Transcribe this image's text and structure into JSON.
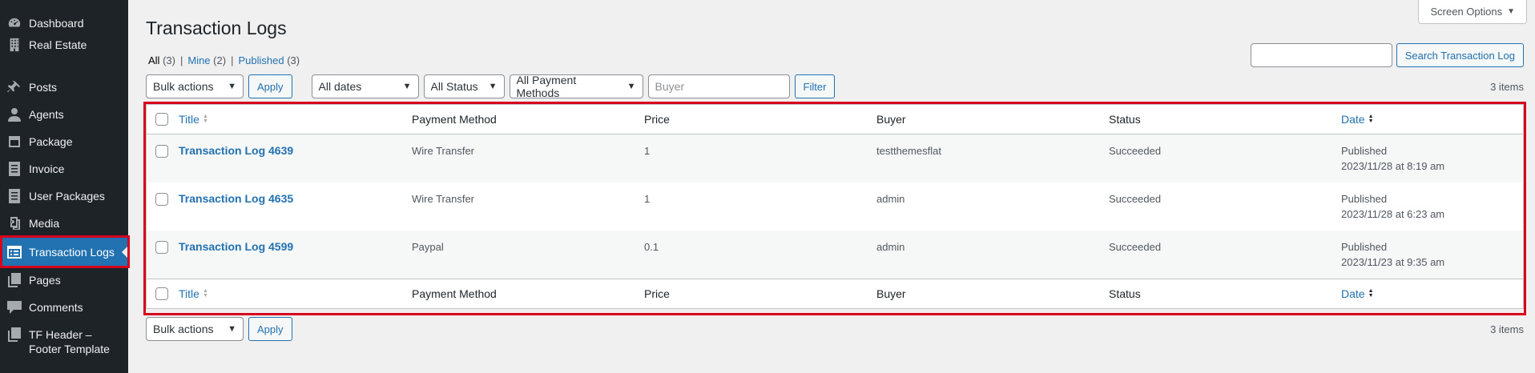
{
  "sidebar": {
    "items": [
      {
        "label": "Dashboard",
        "icon": "dashboard-icon",
        "current": false
      },
      {
        "label": "Real Estate",
        "icon": "building-icon",
        "current": false
      },
      {
        "label": "Posts",
        "icon": "pin-icon",
        "current": false
      },
      {
        "label": "Agents",
        "icon": "user-icon",
        "current": false
      },
      {
        "label": "Package",
        "icon": "box-icon",
        "current": false
      },
      {
        "label": "Invoice",
        "icon": "document-icon",
        "current": false
      },
      {
        "label": "User Packages",
        "icon": "document-icon",
        "current": false
      },
      {
        "label": "Media",
        "icon": "media-icon",
        "current": false
      },
      {
        "label": "Transaction Logs",
        "icon": "list-icon",
        "current": true
      },
      {
        "label": "Pages",
        "icon": "pages-icon",
        "current": false
      },
      {
        "label": "Comments",
        "icon": "comment-icon",
        "current": false
      },
      {
        "label": "TF Header – Footer Template",
        "icon": "pages-icon",
        "current": false
      }
    ]
  },
  "header": {
    "title": "Transaction Logs",
    "screen_options": "Screen Options"
  },
  "filters": {
    "all": "All",
    "all_count": "(3)",
    "mine": "Mine",
    "mine_count": "(2)",
    "published": "Published",
    "published_count": "(3)",
    "sep": "|"
  },
  "search": {
    "placeholder": "",
    "button": "Search Transaction Log"
  },
  "tablenav": {
    "bulk_actions": "Bulk actions",
    "apply": "Apply",
    "all_dates": "All dates",
    "all_status": "All Status",
    "all_payment_methods": "All Payment Methods",
    "buyer_placeholder": "Buyer",
    "filter": "Filter",
    "items_count": "3 items"
  },
  "table": {
    "columns": {
      "title": "Title",
      "payment_method": "Payment Method",
      "price": "Price",
      "buyer": "Buyer",
      "status": "Status",
      "date": "Date"
    },
    "rows": [
      {
        "title": "Transaction Log 4639",
        "payment_method": "Wire Transfer",
        "price": "1",
        "buyer": "testthemesflat",
        "status": "Succeeded",
        "date_status": "Published",
        "date": "2023/11/28 at 8:19 am"
      },
      {
        "title": "Transaction Log 4635",
        "payment_method": "Wire Transfer",
        "price": "1",
        "buyer": "admin",
        "status": "Succeeded",
        "date_status": "Published",
        "date": "2023/11/28 at 6:23 am"
      },
      {
        "title": "Transaction Log 4599",
        "payment_method": "Paypal",
        "price": "0.1",
        "buyer": "admin",
        "status": "Succeeded",
        "date_status": "Published",
        "date": "2023/11/23 at 9:35 am"
      }
    ]
  },
  "colors": {
    "sidebar_bg": "#1d2327",
    "accent": "#2271b1",
    "highlight": "#d6001c"
  }
}
